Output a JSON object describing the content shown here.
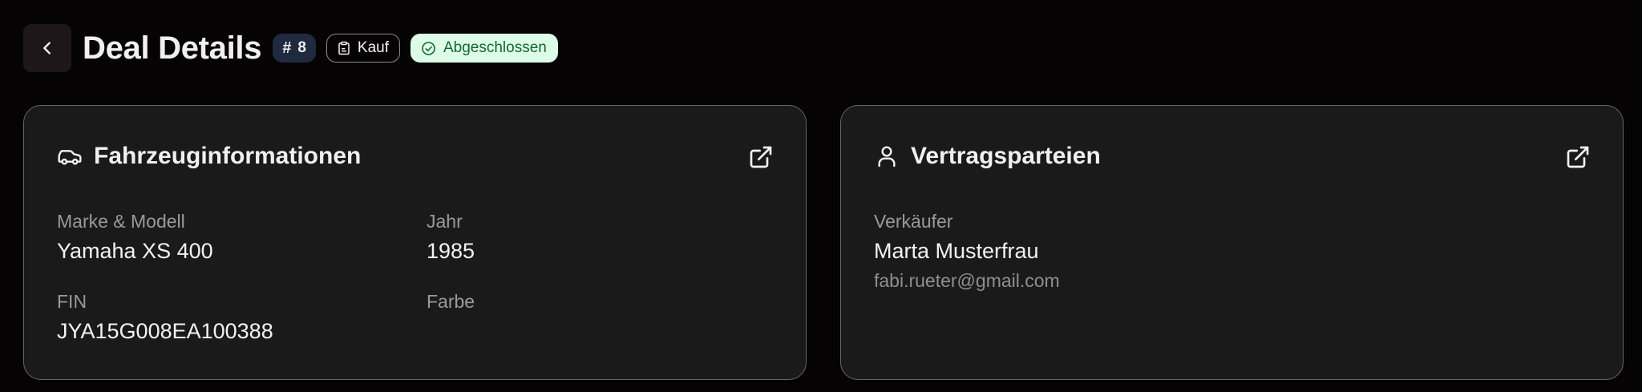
{
  "header": {
    "title": "Deal Details",
    "deal_number": "8",
    "type_label": "Kauf",
    "status_label": "Abgeschlossen"
  },
  "vehicle_card": {
    "title": "Fahrzeuginformationen",
    "fields": [
      {
        "label": "Marke & Modell",
        "value": "Yamaha XS 400"
      },
      {
        "label": "Jahr",
        "value": "1985"
      },
      {
        "label": "FIN",
        "value": "JYA15G008EA100388"
      },
      {
        "label": "Farbe",
        "value": ""
      }
    ]
  },
  "parties_card": {
    "title": "Vertragsparteien",
    "seller_label": "Verkäufer",
    "seller_name": "Marta Musterfrau",
    "seller_email": "fabi.rueter@gmail.com"
  },
  "icons": {
    "back": "chevron-left-icon",
    "hash": "hash-icon",
    "type": "clipboard-icon",
    "status": "check-circle-icon",
    "vehicle": "car-icon",
    "parties": "user-icon",
    "external": "external-link-icon"
  },
  "colors": {
    "background": "#050304",
    "card_bg": "#1a1a1a",
    "status_bg": "#dcfce7",
    "status_fg": "#166534",
    "id_badge_bg": "#1f2a3f"
  }
}
